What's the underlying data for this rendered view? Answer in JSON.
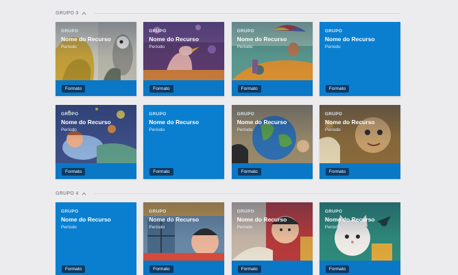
{
  "groups": [
    {
      "title": "GRUPO 3",
      "cards": [
        {
          "group": "GRUPO",
          "name": "Nome do Recurso",
          "period": "Período",
          "format": "Formato",
          "art": "owls"
        },
        {
          "group": "GRUPO",
          "name": "Nome do Recurso",
          "period": "Período",
          "format": "Formato",
          "art": "bird"
        },
        {
          "group": "GRUPO",
          "name": "Nome do Recurso",
          "period": "Período",
          "format": "Formato",
          "art": "umbrella"
        },
        {
          "group": "GRUPO",
          "name": "Nome do Recurso",
          "period": "Período",
          "format": "Formato",
          "art": "plain"
        },
        {
          "group": "GRUPO",
          "name": "Nome do Recurso",
          "period": "Período",
          "format": "Formato",
          "art": "sleep"
        },
        {
          "group": "GRUPO",
          "name": "Nome do Recurso",
          "period": "Período",
          "format": "Formato",
          "art": "plain"
        },
        {
          "group": "GRUPO",
          "name": "Nome do Recurso",
          "period": "Período",
          "format": "Formato",
          "art": "globe"
        },
        {
          "group": "GRUPO",
          "name": "Nome do Recurso",
          "period": "Período",
          "format": "Formato",
          "art": "face"
        }
      ]
    },
    {
      "title": "GRUPO 4",
      "cards": [
        {
          "group": "GRUPO",
          "name": "Nome do Recurso",
          "period": "Período",
          "format": "Formato",
          "art": "plain"
        },
        {
          "group": "GRUPO",
          "name": "Nome do Recurso",
          "period": "Período",
          "format": "Formato",
          "art": "window"
        },
        {
          "group": "GRUPO",
          "name": "Nome do Recurso",
          "period": "Período",
          "format": "Formato",
          "art": "boy"
        },
        {
          "group": "GRUPO",
          "name": "Nome do Recurso",
          "period": "Período",
          "format": "Formato",
          "art": "cat"
        }
      ]
    }
  ],
  "icons": {
    "collapse": "chevron-up-icon"
  },
  "colors": {
    "card_blue": "#0a7fd0",
    "badge": "#0b3a66",
    "background": "#ececee"
  }
}
